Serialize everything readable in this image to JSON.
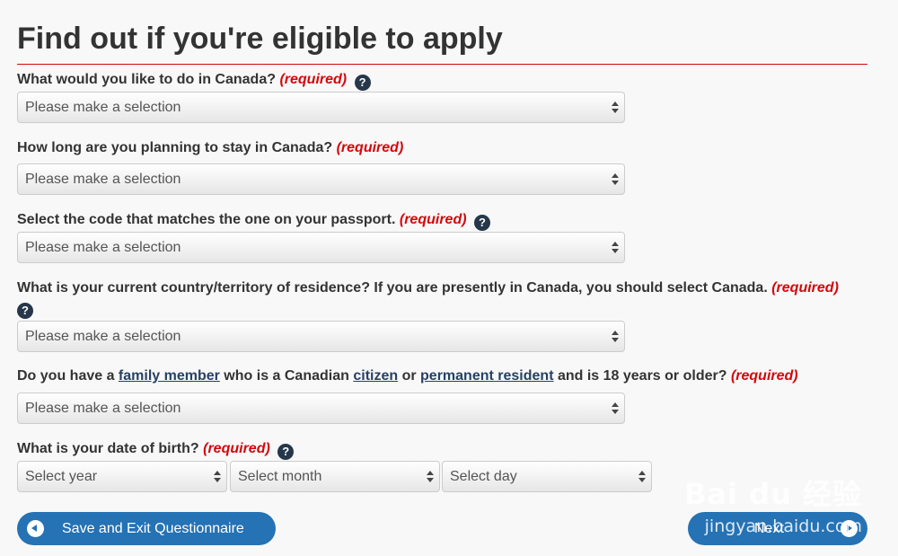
{
  "title": "Find out if you're eligible to apply",
  "required_label": "(required)",
  "help_glyph": "?",
  "questions": [
    {
      "text": "What would you like to do in Canada?",
      "placeholder": "Please make a selection"
    },
    {
      "text": "How long are you planning to stay in Canada?",
      "placeholder": "Please make a selection"
    },
    {
      "text": "Select the code that matches the one on your passport.",
      "placeholder": "Please make a selection"
    },
    {
      "text": "What is your current country/territory of residence? If you are presently in Canada, you should select Canada.",
      "placeholder": "Please make a selection"
    },
    {
      "text_parts": [
        "Do you have a ",
        "family member",
        " who is a Canadian ",
        "citizen",
        " or ",
        "permanent resident",
        " and is 18 years or older?"
      ],
      "placeholder": "Please make a selection"
    },
    {
      "text": "What is your date of birth?",
      "selects": [
        "Select year",
        "Select month",
        "Select day"
      ]
    }
  ],
  "buttons": {
    "save_exit": "Save and Exit Questionnaire",
    "next": "Next"
  },
  "watermark": {
    "logo": "Bai du 经验",
    "url": "jingyan.baidu.com"
  },
  "colors": {
    "required": "#d3080c",
    "button": "#2572b4",
    "help_icon": "#26374a",
    "link": "#284162"
  }
}
